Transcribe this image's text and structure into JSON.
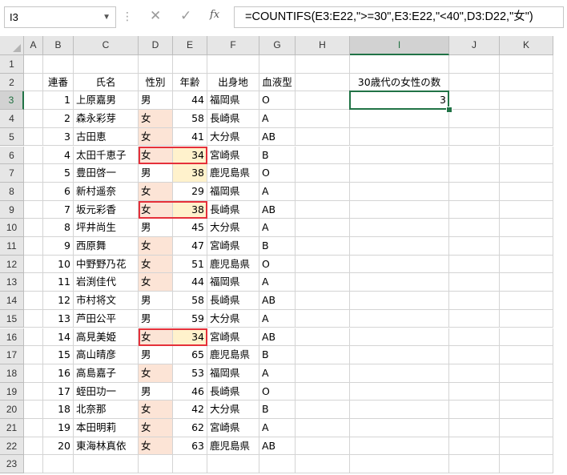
{
  "formula_bar": {
    "name_box": "I3",
    "formula": "=COUNTIFS(E3:E22,\">=30\",E3:E22,\"<40\",D3:D22,\"女\")",
    "icons": {
      "more": "vertical-dots-icon",
      "cancel": "x-icon",
      "enter": "check-icon",
      "function": "fx-icon"
    }
  },
  "columns": [
    "A",
    "B",
    "C",
    "D",
    "E",
    "F",
    "G",
    "H",
    "I",
    "J",
    "K"
  ],
  "selected": {
    "col": "I",
    "row": 3
  },
  "headers": {
    "no": "連番",
    "name": "氏名",
    "gender": "性別",
    "age": "年齢",
    "birthplace": "出身地",
    "blood": "血液型"
  },
  "summary": {
    "label": "30歳代の女性の数",
    "value": "3"
  },
  "rows": [
    {
      "no": "1",
      "name": "上原嘉男",
      "gender": "男",
      "age": "44",
      "place": "福岡県",
      "blood": "O"
    },
    {
      "no": "2",
      "name": "森永彩芽",
      "gender": "女",
      "age": "58",
      "place": "長崎県",
      "blood": "A"
    },
    {
      "no": "3",
      "name": "古田恵",
      "gender": "女",
      "age": "41",
      "place": "大分県",
      "blood": "AB"
    },
    {
      "no": "4",
      "name": "太田千恵子",
      "gender": "女",
      "age": "34",
      "place": "宮崎県",
      "blood": "B"
    },
    {
      "no": "5",
      "name": "豊田啓一",
      "gender": "男",
      "age": "38",
      "place": "鹿児島県",
      "blood": "O"
    },
    {
      "no": "6",
      "name": "新村遥奈",
      "gender": "女",
      "age": "29",
      "place": "福岡県",
      "blood": "A"
    },
    {
      "no": "7",
      "name": "坂元彩香",
      "gender": "女",
      "age": "38",
      "place": "長崎県",
      "blood": "AB"
    },
    {
      "no": "8",
      "name": "坪井尚生",
      "gender": "男",
      "age": "45",
      "place": "大分県",
      "blood": "A"
    },
    {
      "no": "9",
      "name": "西原舞",
      "gender": "女",
      "age": "47",
      "place": "宮崎県",
      "blood": "B"
    },
    {
      "no": "10",
      "name": "中野野乃花",
      "gender": "女",
      "age": "51",
      "place": "鹿児島県",
      "blood": "O"
    },
    {
      "no": "11",
      "name": "岩渕佳代",
      "gender": "女",
      "age": "44",
      "place": "福岡県",
      "blood": "A"
    },
    {
      "no": "12",
      "name": "市村将文",
      "gender": "男",
      "age": "58",
      "place": "長崎県",
      "blood": "AB"
    },
    {
      "no": "13",
      "name": "芦田公平",
      "gender": "男",
      "age": "59",
      "place": "大分県",
      "blood": "A"
    },
    {
      "no": "14",
      "name": "高見美姫",
      "gender": "女",
      "age": "34",
      "place": "宮崎県",
      "blood": "AB"
    },
    {
      "no": "15",
      "name": "高山晴彦",
      "gender": "男",
      "age": "65",
      "place": "鹿児島県",
      "blood": "B"
    },
    {
      "no": "16",
      "name": "高島嘉子",
      "gender": "女",
      "age": "53",
      "place": "福岡県",
      "blood": "A"
    },
    {
      "no": "17",
      "name": "蛭田功一",
      "gender": "男",
      "age": "46",
      "place": "長崎県",
      "blood": "O"
    },
    {
      "no": "18",
      "name": "北奈那",
      "gender": "女",
      "age": "42",
      "place": "大分県",
      "blood": "B"
    },
    {
      "no": "19",
      "name": "本田明莉",
      "gender": "女",
      "age": "62",
      "place": "宮崎県",
      "blood": "A"
    },
    {
      "no": "20",
      "name": "東海林真依",
      "gender": "女",
      "age": "63",
      "place": "鹿児島県",
      "blood": "AB"
    }
  ],
  "extra_rows": [
    "23"
  ],
  "highlight": {
    "female_fill": "#fce4d6",
    "age_fill": "#fff2cc",
    "match_border": "#e5303a",
    "selection": "#217346"
  }
}
